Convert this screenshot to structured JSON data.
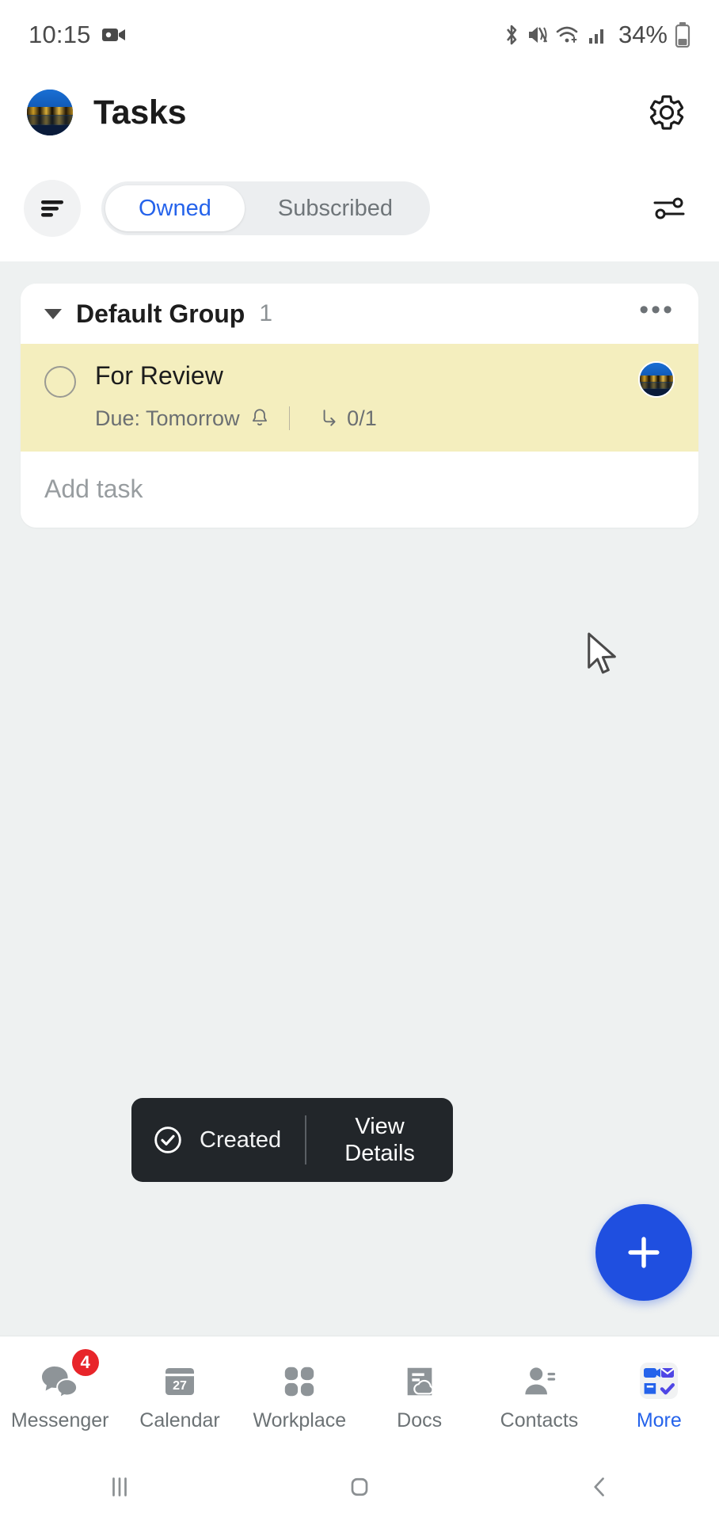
{
  "statusbar": {
    "time": "10:15",
    "battery_percent": "34%",
    "icons": [
      "camera-icon",
      "bluetooth-icon",
      "mute-icon",
      "wifi-icon",
      "cellular-signal-icon",
      "battery-icon"
    ]
  },
  "header": {
    "title": "Tasks",
    "avatar_name": "user-avatar",
    "settings_icon": "gear-icon"
  },
  "tabbar": {
    "list_icon": "list-sort-icon",
    "filter_icon": "filter-sliders-icon",
    "tabs": [
      {
        "label": "Owned",
        "active": true
      },
      {
        "label": "Subscribed",
        "active": false
      }
    ],
    "accent_color": "#2563eb"
  },
  "main": {
    "group": {
      "name": "Default Group",
      "count": "1",
      "menu_icon": "more-options-icon",
      "collapse_icon": "caret-down-icon"
    },
    "tasks": [
      {
        "title": "For Review",
        "due": "Due: Tomorrow",
        "reminder_icon": "bell-icon",
        "subtask_icon": "subtask-icon",
        "subtask_count": "0/1",
        "checkbox": "task-checkbox",
        "assignee": "task-assignee-avatar",
        "highlight_color": "#f4eebe"
      }
    ],
    "add_task_label": "Add task"
  },
  "toast": {
    "icon": "check-circle-icon",
    "message": "Created",
    "action_line1": "View",
    "action_line2": "Details"
  },
  "fab": {
    "icon": "plus-icon",
    "color": "#1f4fe0"
  },
  "bottomnav": {
    "items": [
      {
        "label": "Messenger",
        "icon": "messenger-icon",
        "badge": "4",
        "active": false
      },
      {
        "label": "Calendar",
        "icon": "calendar-icon",
        "day": "27",
        "active": false
      },
      {
        "label": "Workplace",
        "icon": "workplace-grid-icon",
        "active": false
      },
      {
        "label": "Docs",
        "icon": "docs-cloud-icon",
        "active": false
      },
      {
        "label": "Contacts",
        "icon": "contacts-person-icon",
        "active": false
      },
      {
        "label": "More",
        "icon": "more-apps-icon",
        "active": true
      }
    ]
  },
  "androidnav": {
    "items": [
      {
        "name": "recents-button",
        "icon": "recents-icon"
      },
      {
        "name": "home-button",
        "icon": "home-icon"
      },
      {
        "name": "back-button",
        "icon": "back-chevron-icon"
      }
    ]
  },
  "cursor": {
    "icon": "mouse-pointer-icon"
  }
}
